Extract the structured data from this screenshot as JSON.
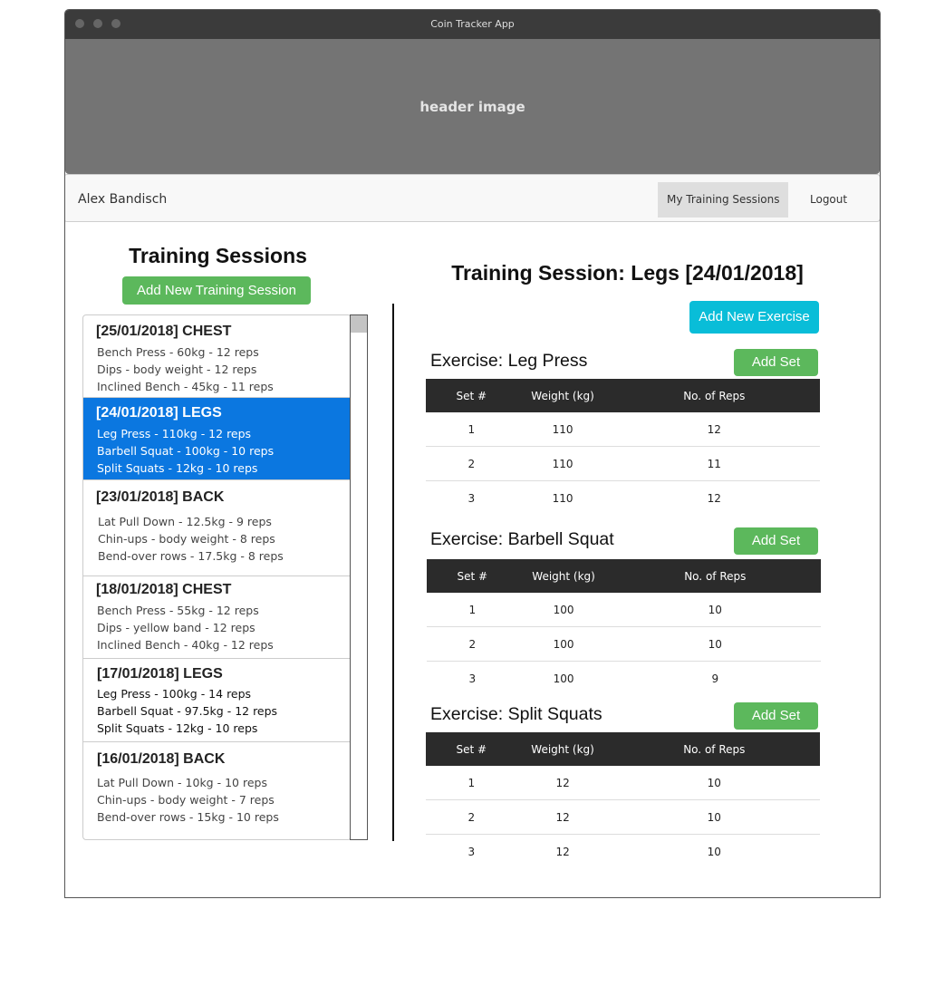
{
  "window": {
    "title": "Coin Tracker App"
  },
  "header": {
    "image_label": "header image"
  },
  "nav": {
    "user_name": "Alex Bandisch",
    "training_sessions": "My Training Sessions",
    "logout": "Logout"
  },
  "left": {
    "title": "Training Sessions",
    "add_button": "Add  New Training Session",
    "sessions": [
      {
        "title": "[25/01/2018] CHEST",
        "lines": [
          "Bench Press - 60kg - 12 reps",
          "Dips - body weight - 12 reps",
          "Inclined Bench - 45kg - 11 reps"
        ]
      },
      {
        "title": "[24/01/2018] LEGS",
        "lines": [
          "Leg Press - 110kg - 12 reps",
          "Barbell Squat - 100kg - 10 reps",
          "Split Squats - 12kg - 10 reps"
        ]
      },
      {
        "title": "[23/01/2018] BACK",
        "lines": [
          "Lat Pull Down - 12.5kg - 9 reps",
          "Chin-ups - body weight - 8 reps",
          "Bend-over rows - 17.5kg - 8 reps"
        ]
      },
      {
        "title": "[18/01/2018] CHEST",
        "lines": [
          "Bench Press - 55kg - 12 reps",
          "Dips - yellow band - 12 reps",
          "Inclined Bench - 40kg - 12 reps"
        ]
      },
      {
        "title": "[17/01/2018] LEGS",
        "lines": [
          "Leg Press - 100kg - 14 reps",
          "Barbell Squat - 97.5kg - 12 reps",
          "Split Squats - 12kg - 10 reps"
        ]
      },
      {
        "title": "[16/01/2018] BACK",
        "lines": [
          "Lat Pull Down - 10kg - 10 reps",
          "Chin-ups - body weight - 7 reps",
          "Bend-over rows - 15kg - 10 reps"
        ]
      }
    ]
  },
  "right": {
    "title": "Training Session: Legs [24/01/2018]",
    "add_exercise": "Add  New Exercise",
    "add_set": "Add  Set",
    "columns": [
      "Set #",
      "Weight (kg)",
      "No. of Reps"
    ],
    "exercises": [
      {
        "title": "Exercise: Leg Press",
        "rows": [
          [
            "1",
            "110",
            "12"
          ],
          [
            "2",
            "110",
            "11"
          ],
          [
            "3",
            "110",
            "12"
          ]
        ]
      },
      {
        "title": "Exercise: Barbell Squat",
        "rows": [
          [
            "1",
            "100",
            "10"
          ],
          [
            "2",
            "100",
            "10"
          ],
          [
            "3",
            "100",
            "9"
          ]
        ]
      },
      {
        "title": "Exercise: Split Squats",
        "rows": [
          [
            "1",
            "12",
            "10"
          ],
          [
            "2",
            "12",
            "10"
          ],
          [
            "3",
            "12",
            "10"
          ]
        ]
      }
    ]
  }
}
